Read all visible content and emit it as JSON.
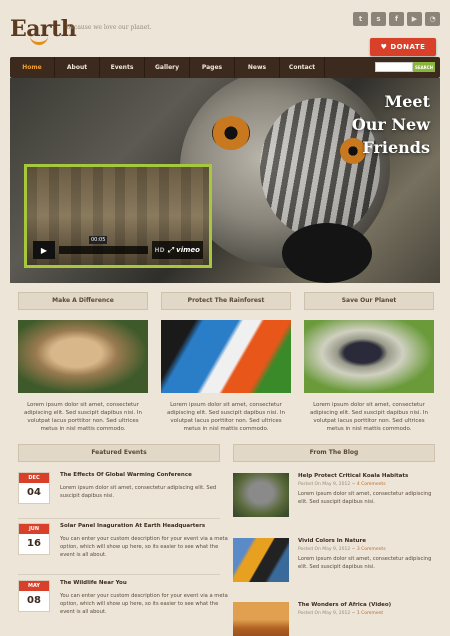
{
  "header": {
    "logo": "Earth",
    "tagline": "Because we love our planet.",
    "donate_label": "DONATE",
    "social_icons": [
      "twitter-icon",
      "stumbleupon-icon",
      "facebook-icon",
      "youtube-icon",
      "rss-icon"
    ]
  },
  "nav": {
    "items": [
      "Home",
      "About",
      "Events",
      "Gallery",
      "Pages",
      "News",
      "Contact"
    ],
    "active": "Home",
    "search_button": "SEARCH",
    "search_placeholder": ""
  },
  "hero": {
    "title_line1": "Meet",
    "title_line2": "Our New",
    "title_line3": "Friends",
    "video_time": "00:05",
    "video_hd": "HD",
    "video_brand": "vimeo"
  },
  "columns": [
    {
      "title": "Make A Difference",
      "text": "Lorem ipsum dolor sit amet, consectetur adipiscing elit. Sed suscipit dapibus nisi. In volutpat lacus porttitor non. Sed ultrices metus in nisl mattis commodo."
    },
    {
      "title": "Protect The Rainforest",
      "text": "Lorem ipsum dolor sit amet, consectetur adipiscing elit. Sed suscipit dapibus nisi. In volutpat lacus porttitor non. Sed ultrices metus in nisl mattis commodo."
    },
    {
      "title": "Save Our Planet",
      "text": "Lorem ipsum dolor sit amet, consectetur adipiscing elit. Sed suscipit dapibus nisi. In volutpat lacus porttitor non. Sed ultrices metus in nisl mattis commodo."
    }
  ],
  "events": {
    "heading": "Featured Events",
    "items": [
      {
        "month": "DEC",
        "day": "04",
        "title": "The Effects Of Global Warming Conference",
        "text": "Lorem ipsum dolor sit amet, consectetur adipiscing elit. Sed suscipit dapibus nisi."
      },
      {
        "month": "JUN",
        "day": "16",
        "title": "Solar Panel Inaguration At Earth Headquarters",
        "text": "You can enter your custom description for your event via a meta option, which will show up here, so its easier to see what the event is all about."
      },
      {
        "month": "MAY",
        "day": "08",
        "title": "The Wildlife Near You",
        "text": "You can enter your custom description for your event via a meta option, which will show up here, so its easier to see what the event is all about."
      }
    ]
  },
  "blog": {
    "heading": "From The Blog",
    "items": [
      {
        "title": "Help Protect Critical Koala Habitats",
        "date": "Posted On May 9, 2012",
        "comments": "4 Comments",
        "text": "Lorem ipsum dolor sit amet, consectetur adipiscing elit. Sed suscipit dapibus nisi."
      },
      {
        "title": "Vivid Colors In Nature",
        "date": "Posted On May 9, 2012",
        "comments": "3 Comments",
        "text": "Lorem ipsum dolor sit amet, consectetur adipiscing elit. Sed suscipit dapibus nisi."
      },
      {
        "title": "The Wonders of Africa (Video)",
        "date": "Posted On May 9, 2012",
        "comments": "1 Comment",
        "text": ""
      }
    ]
  },
  "colors": {
    "accent": "#d8402a",
    "nav_bg": "#3c2a1e",
    "nav_active": "#f0a030",
    "video_border": "#a6c83c",
    "background": "#ece5d8"
  }
}
